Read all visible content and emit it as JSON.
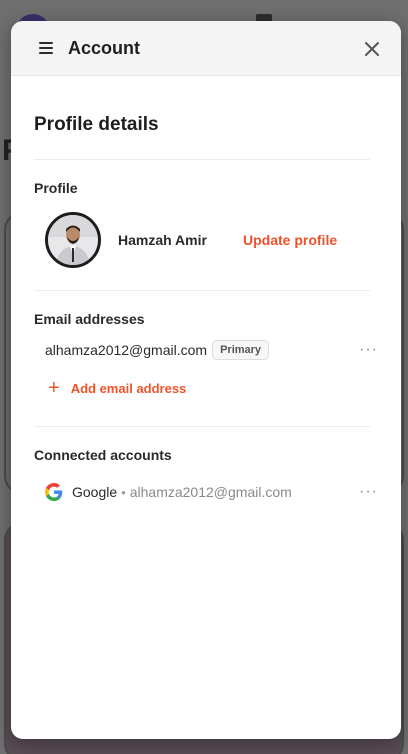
{
  "header": {
    "title": "Account",
    "menu_icon": "hamburger-menu-icon",
    "close_icon": "close-icon"
  },
  "page": {
    "title": "Profile details"
  },
  "profile": {
    "label": "Profile",
    "name": "Hamzah Amir",
    "update_label": "Update profile"
  },
  "emails": {
    "label": "Email addresses",
    "items": [
      {
        "address": "alhamza2012@gmail.com",
        "badge": "Primary",
        "more": "···"
      }
    ],
    "add_label": "Add email address",
    "add_icon": "+"
  },
  "connected": {
    "label": "Connected accounts",
    "items": [
      {
        "provider": "Google",
        "separator": "•",
        "email": "alhamza2012@gmail.com",
        "more": "···"
      }
    ]
  },
  "colors": {
    "accent": "#f0522c",
    "text": "#2a2a2a",
    "muted": "#8a8a8a"
  }
}
